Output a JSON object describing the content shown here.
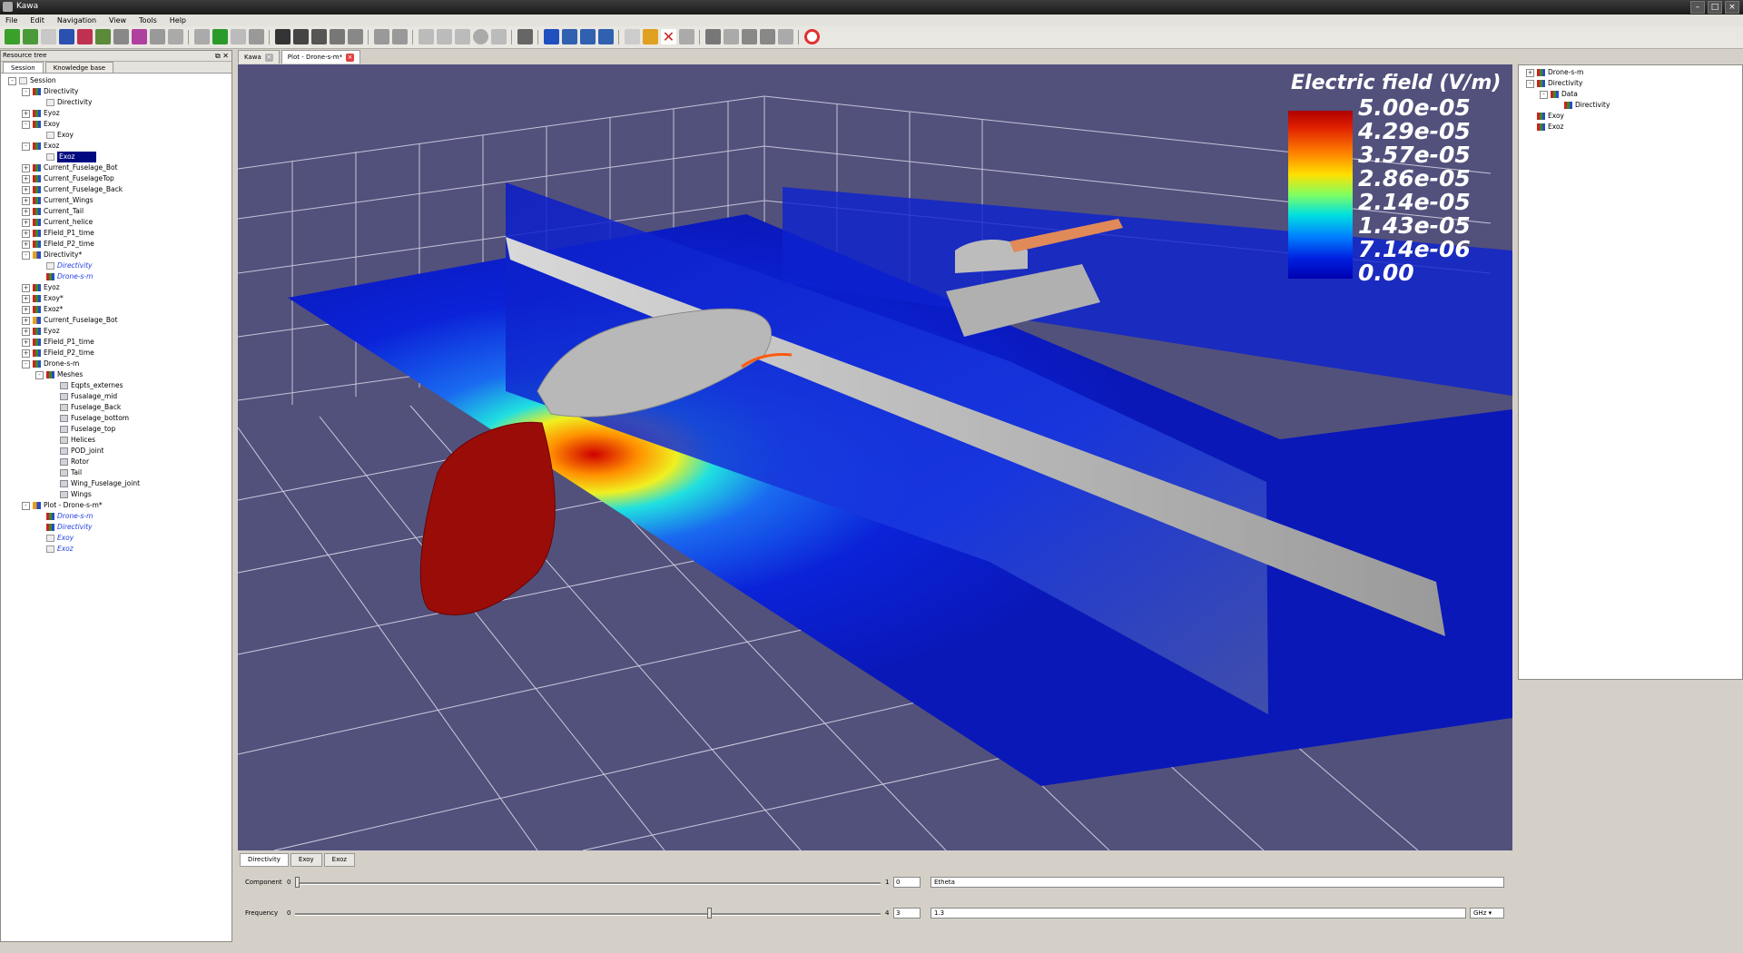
{
  "window": {
    "title": "Kawa",
    "icon": "kawa-app-icon"
  },
  "menu": [
    "File",
    "Edit",
    "Navigation",
    "View",
    "Tools",
    "Help"
  ],
  "left_panel": {
    "title": "Resource tree",
    "tabs": [
      "Session",
      "Knowledge base"
    ],
    "tree": [
      {
        "label": "Session",
        "level": 0,
        "icon": "session-icon",
        "exp": "-"
      },
      {
        "label": "Directivity",
        "level": 1,
        "icon": "chart-icon",
        "exp": "-"
      },
      {
        "label": "Directivity",
        "level": 2,
        "icon": "data-icon",
        "exp": ""
      },
      {
        "label": "Eyoz",
        "level": 1,
        "icon": "chart-icon",
        "exp": "+"
      },
      {
        "label": "Exoy",
        "level": 1,
        "icon": "chart-icon",
        "exp": "-"
      },
      {
        "label": "Exoy",
        "level": 2,
        "icon": "data-icon",
        "exp": ""
      },
      {
        "label": "Exoz",
        "level": 1,
        "icon": "chart-icon",
        "exp": "-"
      },
      {
        "label": "Exoz",
        "level": 2,
        "icon": "data-icon",
        "exp": "",
        "selected": true
      },
      {
        "label": "Current_Fuselage_Bot",
        "level": 1,
        "icon": "chart-icon",
        "exp": "+"
      },
      {
        "label": "Current_FuselageTop",
        "level": 1,
        "icon": "chart-icon",
        "exp": "+"
      },
      {
        "label": "Current_Fuselage_Back",
        "level": 1,
        "icon": "chart-icon",
        "exp": "+"
      },
      {
        "label": "Current_Wings",
        "level": 1,
        "icon": "chart-icon",
        "exp": "+"
      },
      {
        "label": "Current_Tail",
        "level": 1,
        "icon": "chart-icon",
        "exp": "+"
      },
      {
        "label": "Current_helice",
        "level": 1,
        "icon": "chart-icon",
        "exp": "+"
      },
      {
        "label": "EField_P1_time",
        "level": 1,
        "icon": "chart-icon",
        "exp": "+"
      },
      {
        "label": "EField_P2_time",
        "level": 1,
        "icon": "chart-icon",
        "exp": "+"
      },
      {
        "label": "Directivity*",
        "level": 1,
        "icon": "plot-icon",
        "exp": "-"
      },
      {
        "label": "Directivity",
        "level": 2,
        "icon": "data-icon",
        "exp": "",
        "italic": true
      },
      {
        "label": "Drone-s-m",
        "level": 2,
        "icon": "chart-icon",
        "exp": "",
        "italic": true
      },
      {
        "label": "Eyoz",
        "level": 1,
        "icon": "chart-icon",
        "exp": "+"
      },
      {
        "label": "Exoy*",
        "level": 1,
        "icon": "chart-icon",
        "exp": "+"
      },
      {
        "label": "Exoz*",
        "level": 1,
        "icon": "chart-icon",
        "exp": "+"
      },
      {
        "label": "Current_Fuselage_Bot",
        "level": 1,
        "icon": "plot-icon",
        "exp": "+"
      },
      {
        "label": "Eyoz",
        "level": 1,
        "icon": "chart-icon",
        "exp": "+"
      },
      {
        "label": "EField_P1_time",
        "level": 1,
        "icon": "chart-icon",
        "exp": "+"
      },
      {
        "label": "EField_P2_time",
        "level": 1,
        "icon": "chart-icon",
        "exp": "+"
      },
      {
        "label": "Drone-s-m",
        "level": 1,
        "icon": "chart-icon",
        "exp": "-"
      },
      {
        "label": "Meshes",
        "level": 2,
        "icon": "chart-icon",
        "exp": "-"
      },
      {
        "label": "Eqpts_externes",
        "level": 3,
        "icon": "mesh-icon",
        "exp": ""
      },
      {
        "label": "Fusalage_mid",
        "level": 3,
        "icon": "mesh-icon",
        "exp": ""
      },
      {
        "label": "Fuselage_Back",
        "level": 3,
        "icon": "mesh-icon",
        "exp": ""
      },
      {
        "label": "Fuselage_bottom",
        "level": 3,
        "icon": "mesh-icon",
        "exp": ""
      },
      {
        "label": "Fuselage_top",
        "level": 3,
        "icon": "mesh-icon",
        "exp": ""
      },
      {
        "label": "Helices",
        "level": 3,
        "icon": "mesh-icon",
        "exp": ""
      },
      {
        "label": "POD_joint",
        "level": 3,
        "icon": "mesh-icon",
        "exp": ""
      },
      {
        "label": "Rotor",
        "level": 3,
        "icon": "mesh-icon",
        "exp": ""
      },
      {
        "label": "Tail",
        "level": 3,
        "icon": "mesh-icon",
        "exp": ""
      },
      {
        "label": "Wing_Fuselage_joint",
        "level": 3,
        "icon": "mesh-icon",
        "exp": ""
      },
      {
        "label": "Wings",
        "level": 3,
        "icon": "mesh-icon",
        "exp": ""
      },
      {
        "label": "Plot - Drone-s-m*",
        "level": 1,
        "icon": "plot-icon",
        "exp": "-"
      },
      {
        "label": "Drone-s-m",
        "level": 2,
        "icon": "chart-icon",
        "exp": "",
        "italic": true
      },
      {
        "label": "Directivity",
        "level": 2,
        "icon": "chart-icon",
        "exp": "",
        "italic": true
      },
      {
        "label": "Exoy",
        "level": 2,
        "icon": "data-icon",
        "exp": "",
        "italic": true
      },
      {
        "label": "Exoz",
        "level": 2,
        "icon": "data-icon",
        "exp": "",
        "italic": true
      }
    ]
  },
  "doc_tabs": [
    {
      "label": "Kawa",
      "active": false
    },
    {
      "label": "Plot - Drone-s-m*",
      "active": true
    }
  ],
  "viewport": {
    "legend_title": "Electric field (V/m)",
    "legend_ticks": [
      "5.00e-05",
      "4.29e-05",
      "3.57e-05",
      "2.86e-05",
      "2.14e-05",
      "1.43e-05",
      "7.14e-06",
      "0.00"
    ],
    "colors": {
      "background": "#52517c",
      "field_low": "#0a1de0",
      "field_high": "#c81000",
      "mesh": "#bdbdbd",
      "accent": "#e05a20"
    }
  },
  "right_panel": {
    "tree": [
      {
        "label": "Drone-s-m",
        "level": 0,
        "exp": "+"
      },
      {
        "label": "Directivity",
        "level": 0,
        "exp": "-"
      },
      {
        "label": "Data",
        "level": 1,
        "exp": "-"
      },
      {
        "label": "Directivity",
        "level": 2,
        "exp": ""
      },
      {
        "label": "Exoy",
        "level": 0,
        "exp": ""
      },
      {
        "label": "Exoz",
        "level": 0,
        "exp": ""
      }
    ]
  },
  "bottom_panel": {
    "tabs": [
      "Directivity",
      "Exoy",
      "Exoz"
    ],
    "component": {
      "label": "Component",
      "min": "0",
      "max": "1",
      "value": "0",
      "text": "Etheta",
      "position": 0.0
    },
    "frequency": {
      "label": "Frequency",
      "min": "0",
      "max": "4",
      "value": "3",
      "text": "1.3",
      "unit": "GHz",
      "position": 0.71
    }
  }
}
